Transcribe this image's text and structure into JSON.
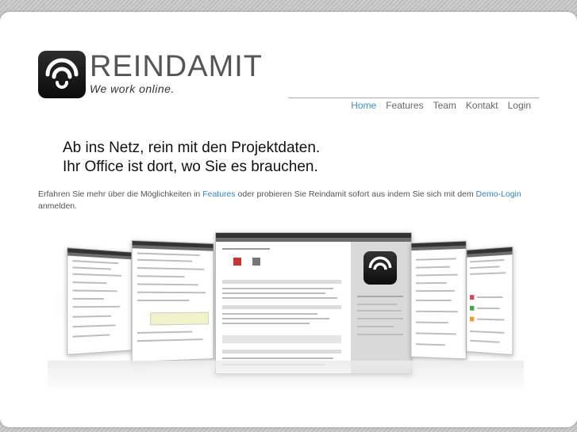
{
  "brand": {
    "name": "REINDAMIT",
    "slogan": "We work online."
  },
  "nav": {
    "items": [
      {
        "label": "Home"
      },
      {
        "label": "Features"
      },
      {
        "label": "Team"
      },
      {
        "label": "Kontakt"
      },
      {
        "label": "Login"
      }
    ]
  },
  "headline": {
    "line1": "Ab ins Netz, rein mit den Projektdaten.",
    "line2": "Ihr Office ist dort, wo Sie es brauchen."
  },
  "intro": {
    "text_before": "Erfahren Sie mehr über die Möglichkeiten in ",
    "link_features": "Features",
    "text_middle": " oder probieren Sie Reindamit sofort aus indem Sie sich mit dem ",
    "link_demo": "Demo-Login",
    "text_after": " anmelden."
  },
  "colors": {
    "accent": "#3e8fc7",
    "link": "#2f86c4",
    "background": "#c9c9c9"
  },
  "icons": {
    "logo": "reindamit-logo-icon"
  }
}
